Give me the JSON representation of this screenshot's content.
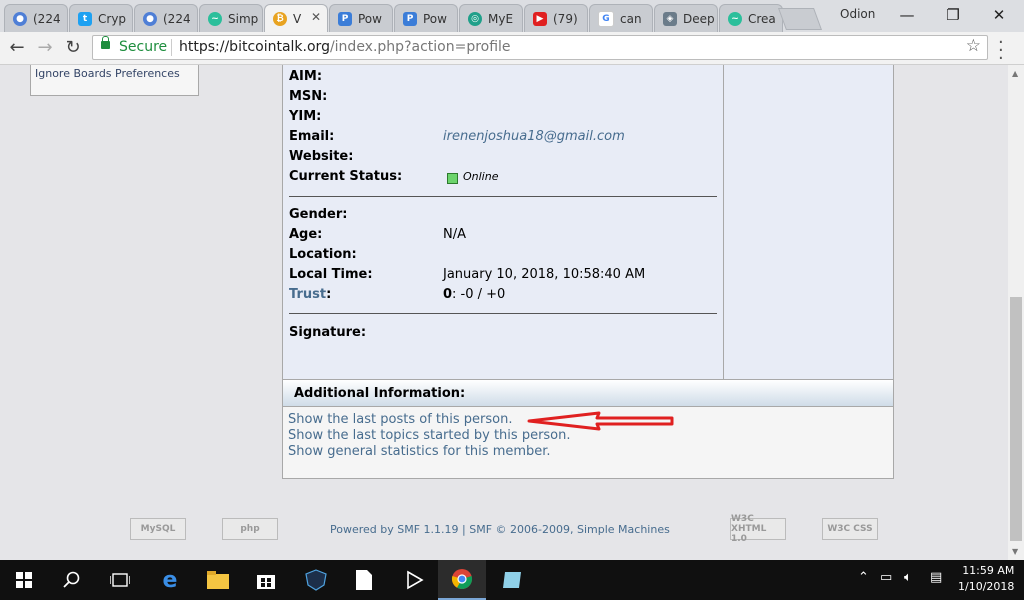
{
  "browser": {
    "tabs": [
      {
        "title": "(224",
        "icon": "drop-icon",
        "color": "#4f7fd6"
      },
      {
        "title": "Cryp",
        "icon": "twitter-icon",
        "color": "#1da1f2"
      },
      {
        "title": "(224",
        "icon": "drop-icon",
        "color": "#4f7fd6"
      },
      {
        "title": "Simp",
        "icon": "swirl-icon",
        "color": "#2bbf9b"
      },
      {
        "title": "V",
        "icon": "bitcoin-icon",
        "color": "#e8a321",
        "active": true
      },
      {
        "title": "Pow",
        "icon": "poll-icon",
        "color": "#3b7dd8"
      },
      {
        "title": "Pow",
        "icon": "poll-icon",
        "color": "#3b7dd8"
      },
      {
        "title": "MyE",
        "icon": "myetherwallet-icon",
        "color": "#20a08a"
      },
      {
        "title": "(79)",
        "icon": "youtube-icon",
        "color": "#e02020"
      },
      {
        "title": "can",
        "icon": "google-icon",
        "color": "#4285f4"
      },
      {
        "title": "Deep",
        "icon": "shield-icon",
        "color": "#6b7c8a"
      },
      {
        "title": "Crea",
        "icon": "swirl-icon",
        "color": "#2bbf9b"
      }
    ],
    "profile_name": "Odion",
    "secure_label": "Secure",
    "url_domain": "https://bitcointalk.org",
    "url_rest": "/index.php?action=profile"
  },
  "sidebar": {
    "ignore_label": "Ignore Boards Preferences"
  },
  "profile": {
    "fields": [
      {
        "label": "AIM:",
        "value": ""
      },
      {
        "label": "MSN:",
        "value": ""
      },
      {
        "label": "YIM:",
        "value": ""
      },
      {
        "label": "Email:",
        "value": "irenenjoshua18@gmail.com"
      },
      {
        "label": "Website:",
        "value": ""
      },
      {
        "label": "Current Status:",
        "value": "Online"
      }
    ],
    "fields2": [
      {
        "label": "Gender:",
        "value": ""
      },
      {
        "label": "Age:",
        "value": "N/A"
      },
      {
        "label": "Location:",
        "value": ""
      },
      {
        "label": "Local Time:",
        "value": "January 10, 2018, 10:58:40 AM"
      }
    ],
    "trust_label": "Trust",
    "trust_colon": ":",
    "trust_score": "0",
    "trust_rest": ": -0 / +0",
    "signature_label": "Signature:"
  },
  "additional": {
    "title": "Additional Information:",
    "links": [
      "Show the last posts of this person.",
      "Show the last topics started by this person.",
      "Show general statistics for this member."
    ]
  },
  "footer": {
    "powered": "Powered by SMF 1.1.19 | SMF © 2006-2009, Simple Machines",
    "badge_mysql": "MySQL",
    "badge_php": "php",
    "badge_xhtml": "W3C XHTML 1.0",
    "badge_css": "W3C CSS"
  },
  "taskbar": {
    "time": "11:59 AM",
    "date": "1/10/2018"
  }
}
